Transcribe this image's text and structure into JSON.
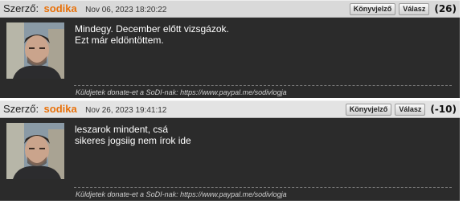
{
  "posts": [
    {
      "author_label": "Szerző:",
      "author_name": "sodika",
      "date": "Nov 06, 2023 18:20:22",
      "quote_button": "Könyvjelző",
      "reply_button": "Válasz",
      "score": "(26)",
      "lines": [
        "Mindegy. December előtt vizsgázok.",
        "Ezt már eldöntöttem."
      ],
      "signature": "Küldjetek donate-et a SoDI-nak: https://www.paypal.me/sodivlogja",
      "avatar_icon": "user-avatar-photo"
    },
    {
      "author_label": "Szerző:",
      "author_name": "sodika",
      "date": "Nov 26, 2023 19:41:12",
      "quote_button": "Könyvjelző",
      "reply_button": "Válasz",
      "score": "(-10)",
      "lines": [
        "leszarok mindent, csá",
        "sikeres jogsiig nem írok ide"
      ],
      "signature": "Küldjetek donate-et a SoDI-nak: https://www.paypal.me/sodivlogja",
      "avatar_icon": "user-avatar-photo"
    }
  ],
  "colors": {
    "author": "#e8710a",
    "post_bg": "#2b2b2b",
    "header_bg": "#d9d9d9"
  }
}
